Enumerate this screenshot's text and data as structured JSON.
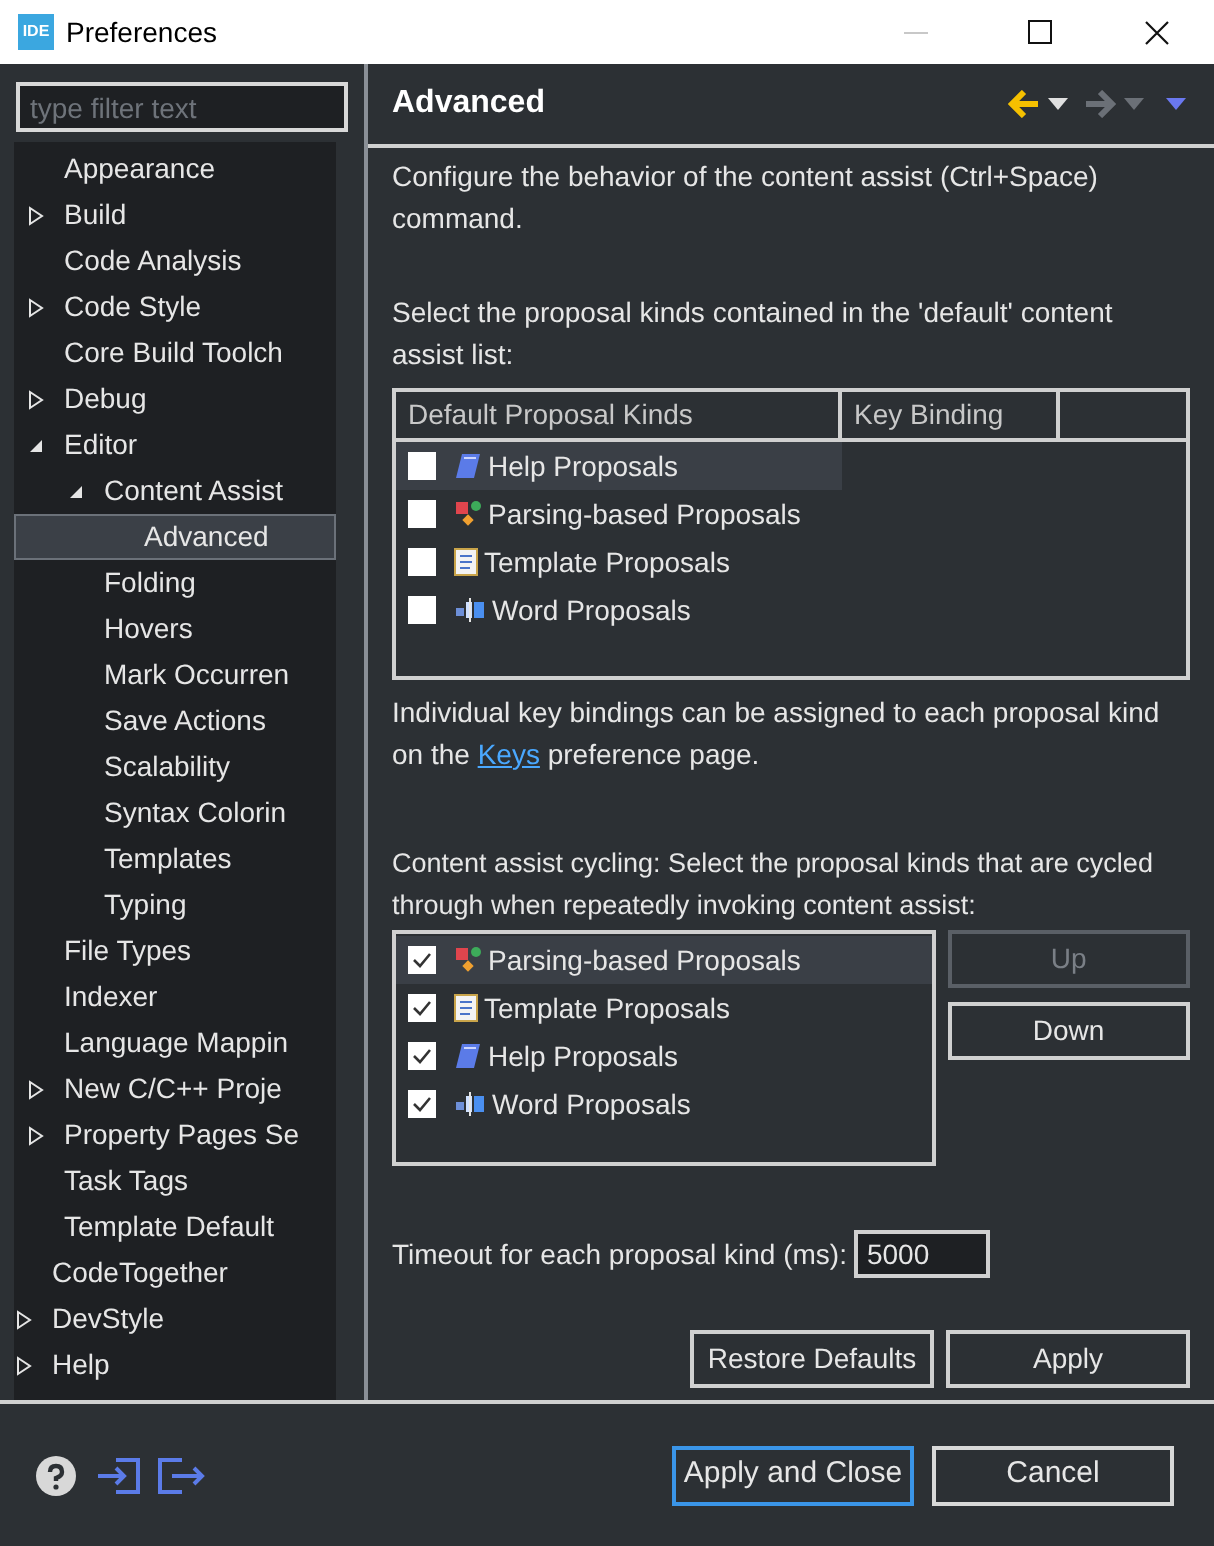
{
  "window": {
    "title": "Preferences",
    "app_badge": "IDE"
  },
  "filter": {
    "placeholder": "type filter text"
  },
  "tree": [
    {
      "children": [
        {
          "label": "Appearance",
          "selected": false
        },
        {
          "label": "Build",
          "expanded": false,
          "selected": false
        },
        {
          "label": "Code Analysis",
          "selected": false
        },
        {
          "label": "Code Style",
          "expanded": false,
          "selected": false
        },
        {
          "label": "Core Build Toolch",
          "selected": false
        },
        {
          "label": "Debug",
          "expanded": false,
          "selected": false
        },
        {
          "label": "Editor",
          "expanded": true,
          "selected": false,
          "children": [
            {
              "label": "Content Assist",
              "expanded": true,
              "selected": false,
              "children": [
                {
                  "label": "Advanced",
                  "selected": true
                }
              ]
            },
            {
              "label": "Folding",
              "selected": false
            },
            {
              "label": "Hovers",
              "selected": false
            },
            {
              "label": "Mark Occurren",
              "selected": false
            },
            {
              "label": "Save Actions",
              "selected": false
            },
            {
              "label": "Scalability",
              "selected": false
            },
            {
              "label": "Syntax Colorin",
              "selected": false
            },
            {
              "label": "Templates",
              "selected": false
            },
            {
              "label": "Typing",
              "selected": false
            }
          ]
        },
        {
          "label": "File Types",
          "selected": false
        },
        {
          "label": "Indexer",
          "selected": false
        },
        {
          "label": "Language Mappin",
          "selected": false
        },
        {
          "label": "New C/C++ Proje",
          "expanded": false,
          "selected": false
        },
        {
          "label": "Property Pages Se",
          "expanded": false,
          "selected": false
        },
        {
          "label": "Task Tags",
          "selected": false
        },
        {
          "label": "Template Default",
          "selected": false
        }
      ]
    },
    {
      "label": "CodeTogether",
      "selected": false
    },
    {
      "label": "DevStyle",
      "expanded": false,
      "selected": false
    },
    {
      "label": "Help",
      "expanded": false,
      "selected": false
    }
  ],
  "page": {
    "title": "Advanced",
    "back_enabled": true,
    "forward_enabled": false
  },
  "intro": "Configure the behavior of the content assist (Ctrl+Space) command.",
  "default_list_label": "Select the proposal kinds contained in the 'default' content assist list:",
  "default_table": {
    "columns": [
      "Default Proposal Kinds",
      "Key Binding"
    ],
    "rows": [
      {
        "kind": "help",
        "label": "Help Proposals",
        "checked": false,
        "selected": true
      },
      {
        "kind": "parsing",
        "label": "Parsing-based Proposals",
        "checked": false,
        "selected": false
      },
      {
        "kind": "template",
        "label": "Template Proposals",
        "checked": false,
        "selected": false
      },
      {
        "kind": "word",
        "label": "Word Proposals",
        "checked": false,
        "selected": false
      }
    ]
  },
  "keys_note": {
    "before": "Individual key bindings can be assigned to each proposal kind on the ",
    "link": "Keys",
    "after": " preference page."
  },
  "cycling_label": "Content assist cycling: Select the proposal kinds that are cycled through when repeatedly invoking content assist:",
  "cycling_list": [
    {
      "kind": "parsing",
      "label": "Parsing-based Proposals",
      "checked": true,
      "selected": true
    },
    {
      "kind": "template",
      "label": "Template Proposals",
      "checked": true,
      "selected": false
    },
    {
      "kind": "help",
      "label": "Help Proposals",
      "checked": true,
      "selected": false
    },
    {
      "kind": "word",
      "label": "Word Proposals",
      "checked": true,
      "selected": false
    }
  ],
  "order_buttons": [
    {
      "label": "Up",
      "disabled": true
    },
    {
      "label": "Down",
      "disabled": false
    }
  ],
  "timeout": {
    "label": "Timeout for each proposal kind (ms):",
    "value": "5000"
  },
  "page_buttons": [
    "Restore Defaults",
    "Apply"
  ],
  "footer_buttons": [
    {
      "label": "Apply and Close",
      "default": true
    },
    {
      "label": "Cancel",
      "default": false
    }
  ]
}
